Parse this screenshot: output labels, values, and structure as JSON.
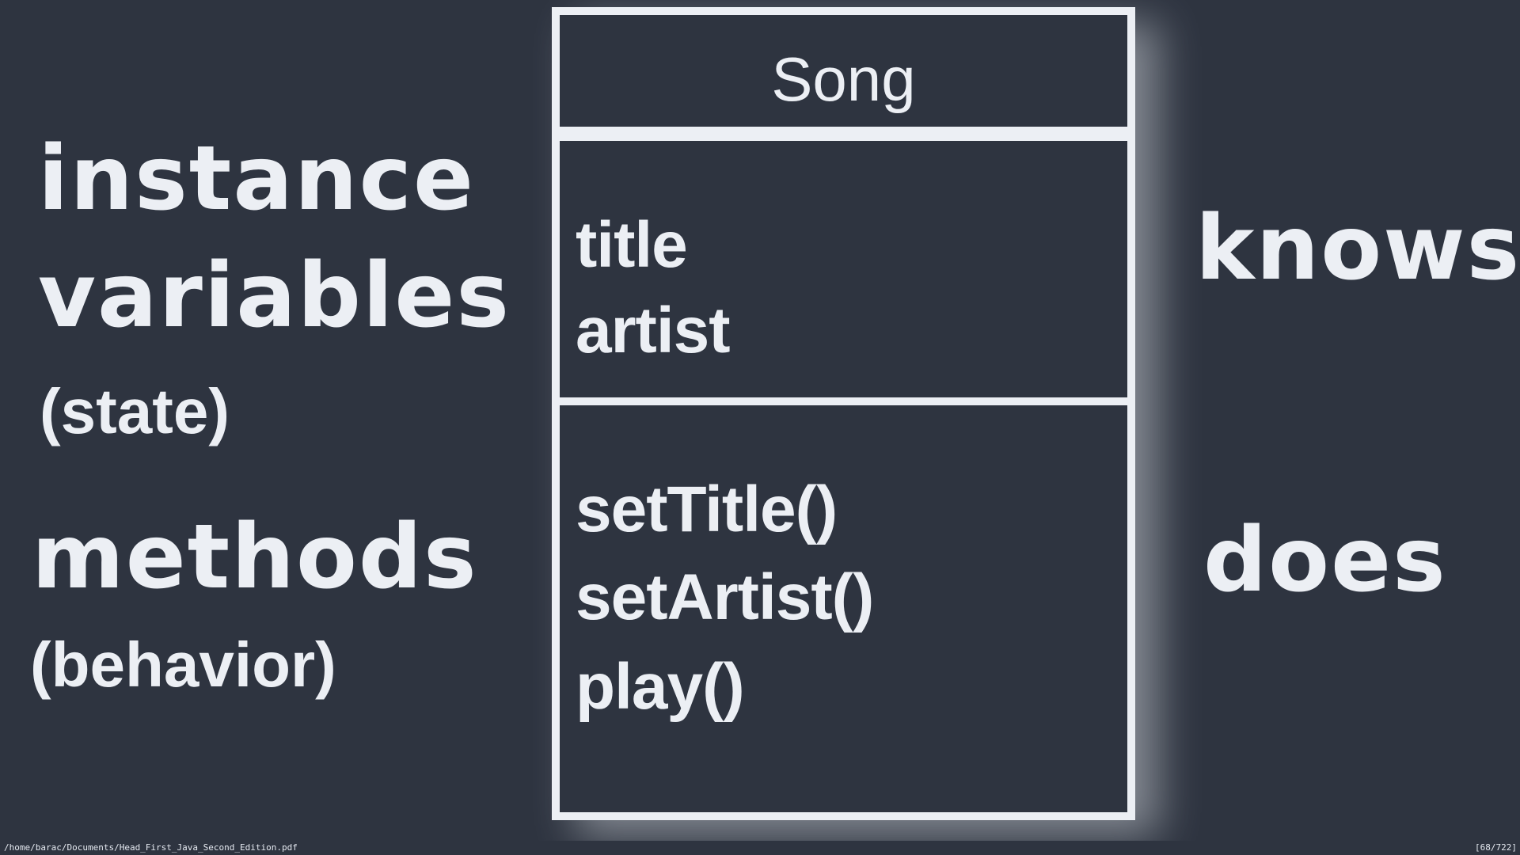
{
  "left_labels": {
    "instance_line1": "instance",
    "instance_line2": "variables",
    "state": "(state)",
    "methods": "methods",
    "behavior": "(behavior)"
  },
  "right_labels": {
    "knows": "knows",
    "does": "does"
  },
  "uml": {
    "class_name": "Song",
    "instance_variables": [
      "title",
      "artist"
    ],
    "methods": [
      "setTitle()",
      "setArtist()",
      "play()"
    ]
  },
  "statusbar": {
    "file_path": "/home/barac/Documents/Head_First_Java_Second_Edition.pdf",
    "page_indicator": "[68/722]"
  }
}
